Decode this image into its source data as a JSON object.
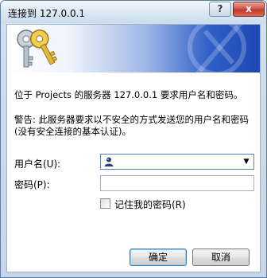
{
  "window": {
    "title": "连接到 127.0.0.1",
    "help_label": "?",
    "close_label": "x"
  },
  "message": {
    "line1": "位于 Projects 的服务器 127.0.0.1 要求用户名和密码。",
    "line2": "警告: 此服务器要求以不安全的方式发送您的用户名和密码(没有安全连接的基本认证)。"
  },
  "form": {
    "username_label": "用户名(U):",
    "username_value": "",
    "password_label": "密码(P):",
    "password_value": "",
    "remember_label": "记住我的密码(R)",
    "remember_checked": false
  },
  "buttons": {
    "ok_label": "确定",
    "cancel_label": "取消"
  },
  "icons": {
    "banner": "keys-icon",
    "user_picker": "user-icon",
    "dropdown": "chevron-down-icon"
  },
  "colors": {
    "banner_blue": "#2f5fc7",
    "key_gold": "#e2b739",
    "key_silver": "#b8c2cc"
  }
}
